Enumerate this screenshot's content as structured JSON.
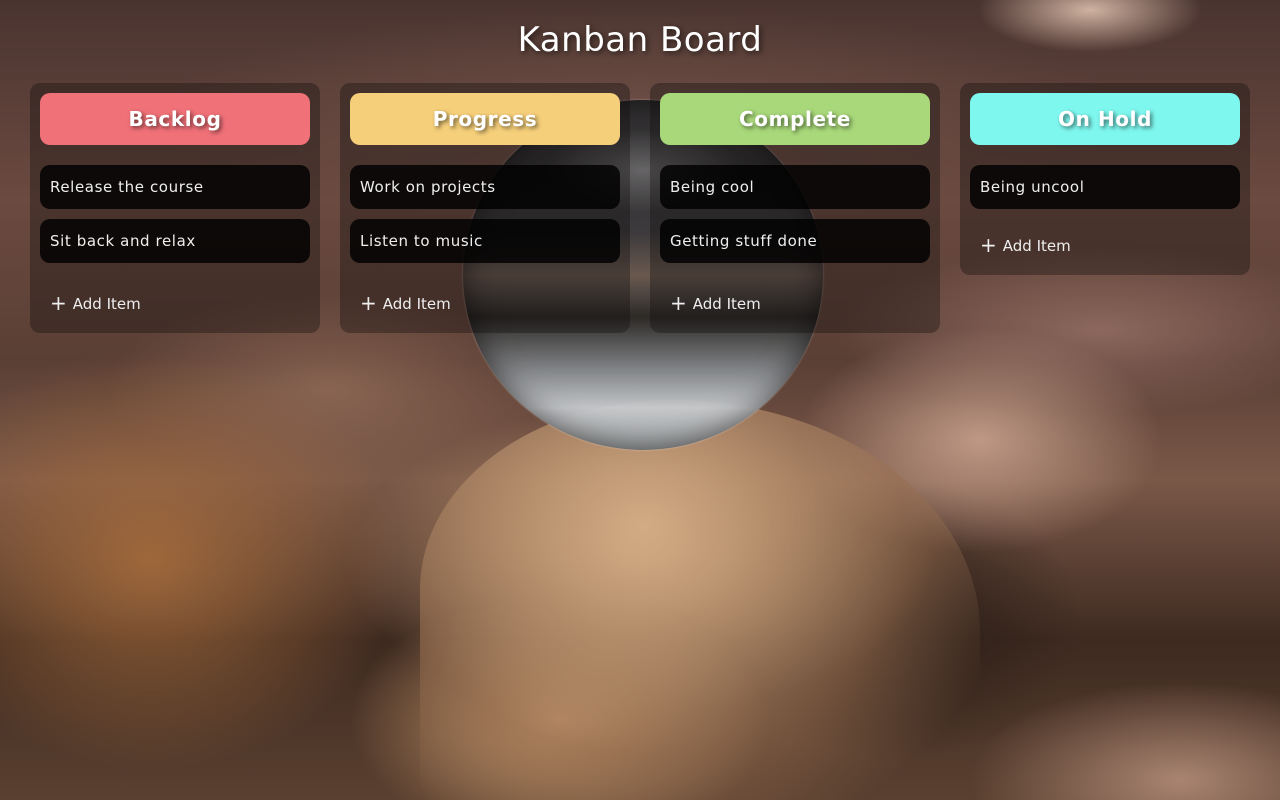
{
  "title": "Kanban Board",
  "columns": [
    {
      "name": "Backlog",
      "color": "#f07178",
      "items": [
        "Release the course",
        "Sit back and relax"
      ],
      "add_label": "Add Item"
    },
    {
      "name": "Progress",
      "color": "#f5cf7a",
      "items": [
        "Work on projects",
        "Listen to music"
      ],
      "add_label": "Add Item"
    },
    {
      "name": "Complete",
      "color": "#a8d87a",
      "items": [
        "Being cool",
        "Getting stuff done"
      ],
      "add_label": "Add Item"
    },
    {
      "name": "On Hold",
      "color": "#7ef7ee",
      "items": [
        "Being uncool"
      ],
      "add_label": "Add Item"
    }
  ],
  "icons": {
    "add": "plus-icon"
  }
}
